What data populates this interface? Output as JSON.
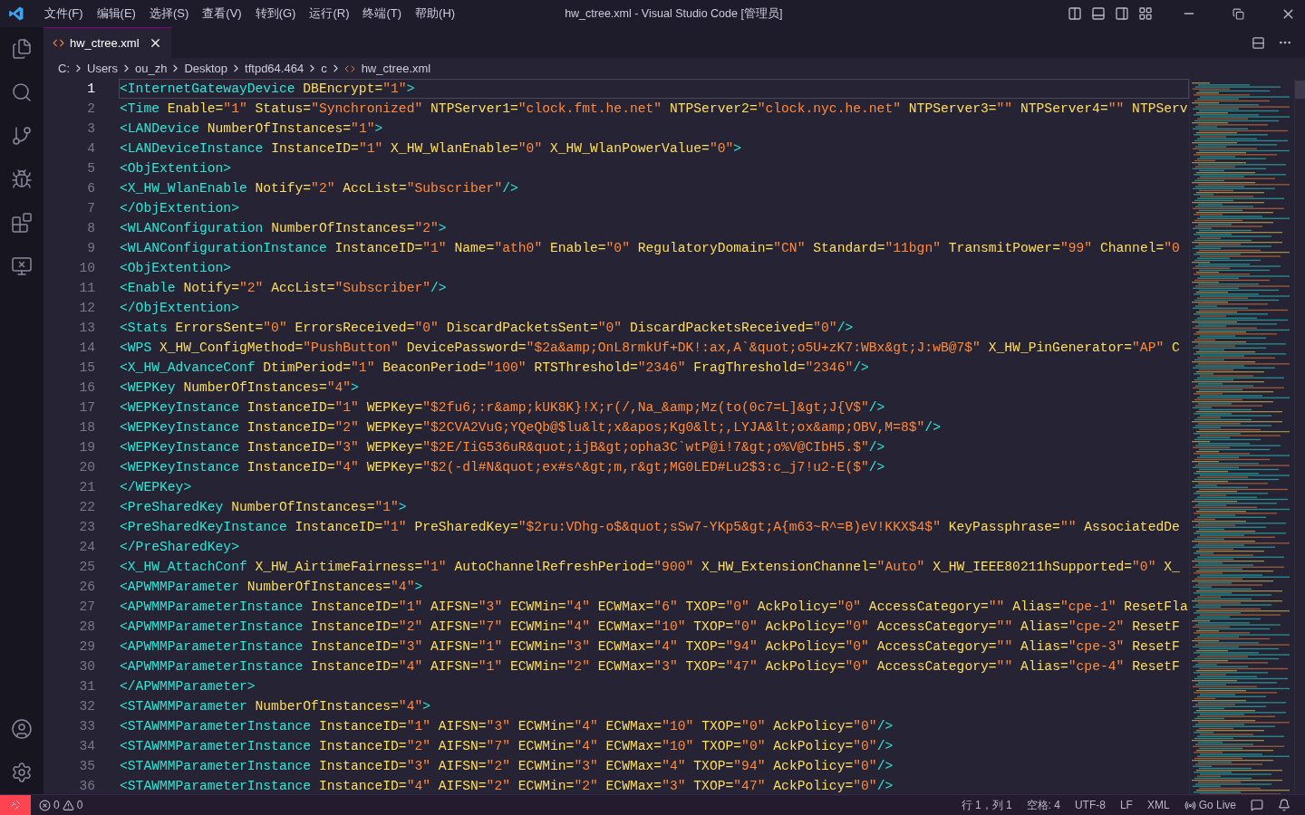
{
  "menu": [
    "文件(F)",
    "编辑(E)",
    "选择(S)",
    "查看(V)",
    "转到(G)",
    "运行(R)",
    "终端(T)",
    "帮助(H)"
  ],
  "window_title": "hw_ctree.xml - Visual Studio Code [管理员]",
  "tabs": [
    {
      "label": "hw_ctree.xml",
      "selected": true
    }
  ],
  "breadcrumbs": [
    "C:",
    "Users",
    "ou_zh",
    "Desktop",
    "tftpd64.464",
    "c",
    "hw_ctree.xml"
  ],
  "editor": {
    "lines": [
      {
        "number": "1",
        "text": "<InternetGatewayDevice DBEncrypt=\"1\">",
        "selected": true
      },
      {
        "number": "2",
        "text": "<Time Enable=\"1\" Status=\"Synchronized\" NTPServer1=\"clock.fmt.he.net\" NTPServer2=\"clock.nyc.he.net\" NTPServer3=\"\" NTPServer4=\"\" NTPServ",
        "selected": false
      },
      {
        "number": "3",
        "text": "<LANDevice NumberOfInstances=\"1\">",
        "selected": false
      },
      {
        "number": "4",
        "text": "<LANDeviceInstance InstanceID=\"1\" X_HW_WlanEnable=\"0\" X_HW_WlanPowerValue=\"0\">",
        "selected": false
      },
      {
        "number": "5",
        "text": "<ObjExtention>",
        "selected": false
      },
      {
        "number": "6",
        "text": "<X_HW_WlanEnable Notify=\"2\" AccList=\"Subscriber\"/>",
        "selected": false
      },
      {
        "number": "7",
        "text": "</ObjExtention>",
        "selected": false
      },
      {
        "number": "8",
        "text": "<WLANConfiguration NumberOfInstances=\"2\">",
        "selected": false
      },
      {
        "number": "9",
        "text": "<WLANConfigurationInstance InstanceID=\"1\" Name=\"ath0\" Enable=\"0\" RegulatoryDomain=\"CN\" Standard=\"11bgn\" TransmitPower=\"99\" Channel=\"0",
        "selected": false
      },
      {
        "number": "10",
        "text": "<ObjExtention>",
        "selected": false
      },
      {
        "number": "11",
        "text": "<Enable Notify=\"2\" AccList=\"Subscriber\"/>",
        "selected": false
      },
      {
        "number": "12",
        "text": "</ObjExtention>",
        "selected": false
      },
      {
        "number": "13",
        "text": "<Stats ErrorsSent=\"0\" ErrorsReceived=\"0\" DiscardPacketsSent=\"0\" DiscardPacketsReceived=\"0\"/>",
        "selected": false
      },
      {
        "number": "14",
        "text": "<WPS X_HW_ConfigMethod=\"PushButton\" DevicePassword=\"$2a&amp;OnL8rmkUf+DK!:ax,A`&quot;o5U+zK7:WBx&gt;J:wB@7$\" X_HW_PinGenerator=\"AP\" C",
        "selected": false
      },
      {
        "number": "15",
        "text": "<X_HW_AdvanceConf DtimPeriod=\"1\" BeaconPeriod=\"100\" RTSThreshold=\"2346\" FragThreshold=\"2346\"/>",
        "selected": false
      },
      {
        "number": "16",
        "text": "<WEPKey NumberOfInstances=\"4\">",
        "selected": false
      },
      {
        "number": "17",
        "text": "<WEPKeyInstance InstanceID=\"1\" WEPKey=\"$2fu6;:r&amp;kUK8K}!X;r(/,Na_&amp;Mz(to(0c7=L]&gt;J{V$\"/>",
        "selected": false
      },
      {
        "number": "18",
        "text": "<WEPKeyInstance InstanceID=\"2\" WEPKey=\"$2CVA2VuG;YQeQb@$lu&lt;x&apos;Kg0&lt;,LYJA&lt;ox&amp;OBV,M=8$\"/>",
        "selected": false
      },
      {
        "number": "19",
        "text": "<WEPKeyInstance InstanceID=\"3\" WEPKey=\"$2E/IiG536uR&quot;ijB&gt;opha3C`wtP@i!7&gt;o%V@CIbH5.$\"/>",
        "selected": false
      },
      {
        "number": "20",
        "text": "<WEPKeyInstance InstanceID=\"4\" WEPKey=\"$2(-dl#N&quot;ex#s^&gt;m,r&gt;MG0LED#Lu2$3:c_j7!u2-E($\"/>",
        "selected": false
      },
      {
        "number": "21",
        "text": "</WEPKey>",
        "selected": false
      },
      {
        "number": "22",
        "text": "<PreSharedKey NumberOfInstances=\"1\">",
        "selected": false
      },
      {
        "number": "23",
        "text": "<PreSharedKeyInstance InstanceID=\"1\" PreSharedKey=\"$2ru:VDhg-o$&quot;sSw7-YKp5&gt;A{m63~R^=B)eV!KKX$4$\" KeyPassphrase=\"\" AssociatedDe",
        "selected": false
      },
      {
        "number": "24",
        "text": "</PreSharedKey>",
        "selected": false
      },
      {
        "number": "25",
        "text": "<X_HW_AttachConf X_HW_AirtimeFairness=\"1\" AutoChannelRefreshPeriod=\"900\" X_HW_ExtensionChannel=\"Auto\" X_HW_IEEE80211hSupported=\"0\" X_",
        "selected": false
      },
      {
        "number": "26",
        "text": "<APWMMParameter NumberOfInstances=\"4\">",
        "selected": false
      },
      {
        "number": "27",
        "text": "<APWMMParameterInstance InstanceID=\"1\" AIFSN=\"3\" ECWMin=\"4\" ECWMax=\"6\" TXOP=\"0\" AckPolicy=\"0\" AccessCategory=\"\" Alias=\"cpe-1\" ResetFla",
        "selected": false
      },
      {
        "number": "28",
        "text": "<APWMMParameterInstance InstanceID=\"2\" AIFSN=\"7\" ECWMin=\"4\" ECWMax=\"10\" TXOP=\"0\" AckPolicy=\"0\" AccessCategory=\"\" Alias=\"cpe-2\" ResetF",
        "selected": false
      },
      {
        "number": "29",
        "text": "<APWMMParameterInstance InstanceID=\"3\" AIFSN=\"1\" ECWMin=\"3\" ECWMax=\"4\" TXOP=\"94\" AckPolicy=\"0\" AccessCategory=\"\" Alias=\"cpe-3\" ResetF",
        "selected": false
      },
      {
        "number": "30",
        "text": "<APWMMParameterInstance InstanceID=\"4\" AIFSN=\"1\" ECWMin=\"2\" ECWMax=\"3\" TXOP=\"47\" AckPolicy=\"0\" AccessCategory=\"\" Alias=\"cpe-4\" ResetF",
        "selected": false
      },
      {
        "number": "31",
        "text": "</APWMMParameter>",
        "selected": false
      },
      {
        "number": "32",
        "text": "<STAWMMParameter NumberOfInstances=\"4\">",
        "selected": false
      },
      {
        "number": "33",
        "text": "<STAWMMParameterInstance InstanceID=\"1\" AIFSN=\"3\" ECWMin=\"4\" ECWMax=\"10\" TXOP=\"0\" AckPolicy=\"0\"/>",
        "selected": false
      },
      {
        "number": "34",
        "text": "<STAWMMParameterInstance InstanceID=\"2\" AIFSN=\"7\" ECWMin=\"4\" ECWMax=\"10\" TXOP=\"0\" AckPolicy=\"0\"/>",
        "selected": false
      },
      {
        "number": "35",
        "text": "<STAWMMParameterInstance InstanceID=\"3\" AIFSN=\"2\" ECWMin=\"3\" ECWMax=\"4\" TXOP=\"94\" AckPolicy=\"0\"/>",
        "selected": false
      },
      {
        "number": "36",
        "text": "<STAWMMParameterInstance InstanceID=\"4\" AIFSN=\"2\" ECWMin=\"2\" ECWMax=\"3\" TXOP=\"47\" AckPolicy=\"0\"/>",
        "selected": false
      }
    ]
  },
  "status_bar": {
    "errors": "0",
    "warnings": "0",
    "items": [
      "行 1，列 1",
      "空格: 4",
      "UTF-8",
      "LF",
      "XML"
    ],
    "go_live": "Go Live"
  }
}
